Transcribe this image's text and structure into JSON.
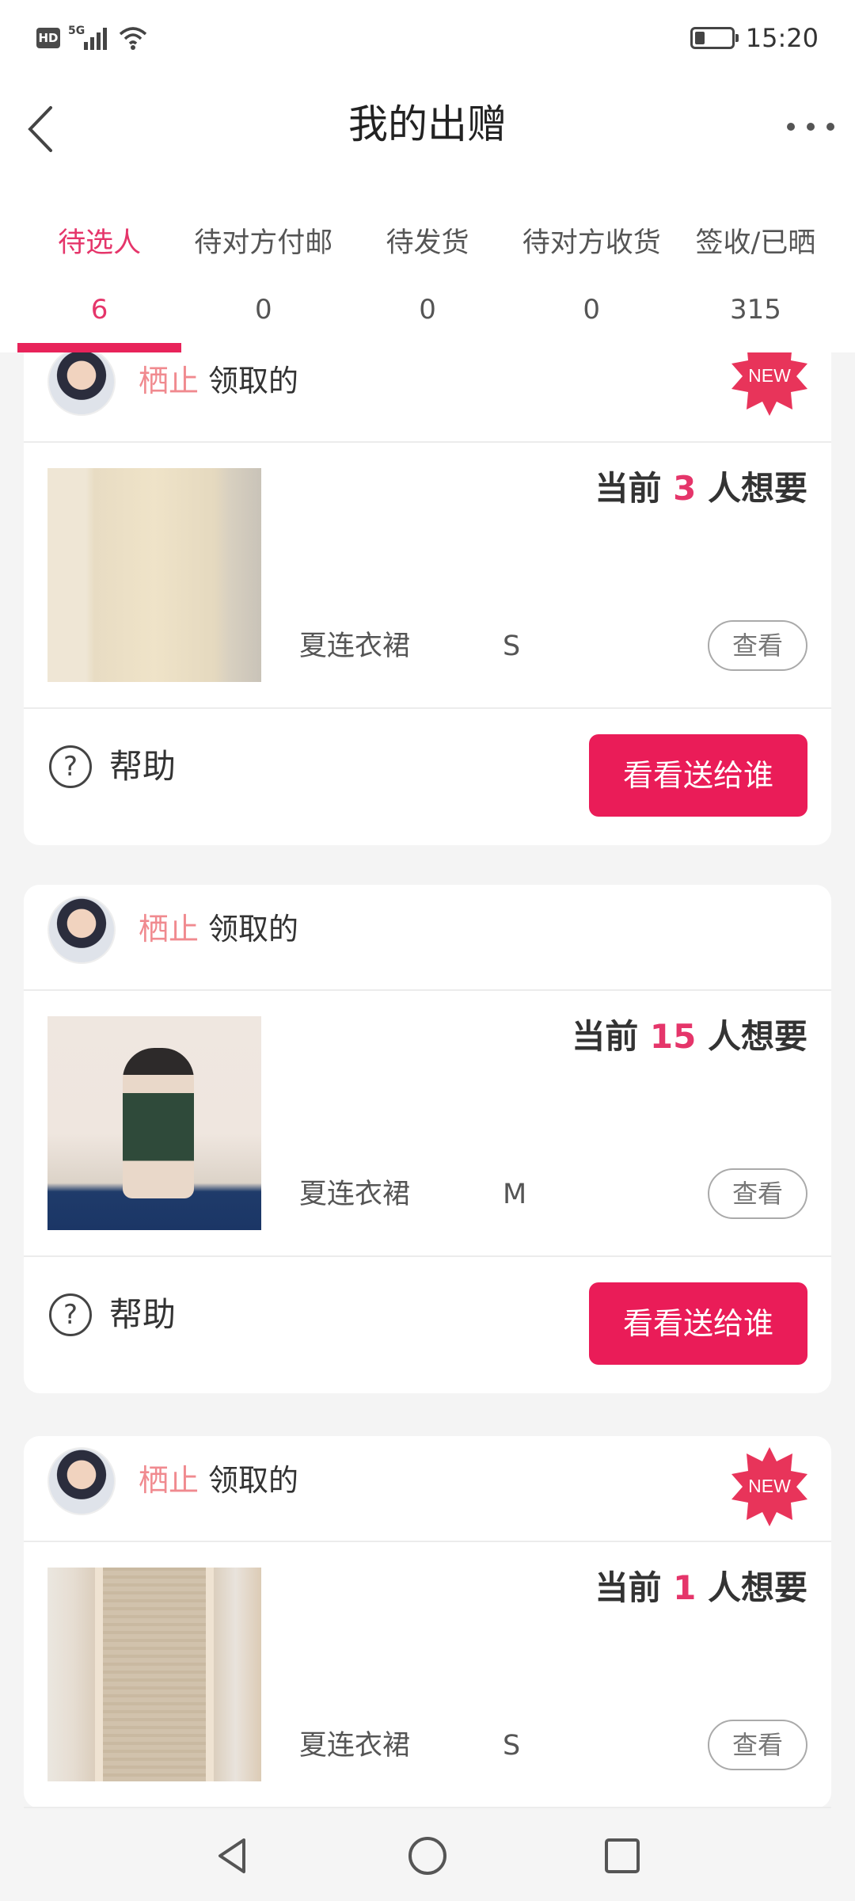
{
  "status_bar": {
    "time": "15:20",
    "hd_label": "HD",
    "network_label": "5G"
  },
  "header": {
    "title": "我的出赠"
  },
  "tabs": [
    {
      "label": "待选人",
      "count": "6",
      "active": true
    },
    {
      "label": "待对方付邮",
      "count": "0"
    },
    {
      "label": "待发货",
      "count": "0"
    },
    {
      "label": "待对方收货",
      "count": "0"
    },
    {
      "label": "签收/已晒",
      "count": "315"
    }
  ],
  "cards": [
    {
      "claimer_name": "栖止",
      "claimer_suffix": "领取的",
      "new_badge": "NEW",
      "want_prefix": "当前",
      "want_count": "3",
      "want_suffix": "人想要",
      "item_name": "夏连衣裙",
      "item_size": "S",
      "view_label": "查看",
      "help_label": "帮助",
      "gift_label": "看看送给谁"
    },
    {
      "claimer_name": "栖止",
      "claimer_suffix": "领取的",
      "want_prefix": "当前",
      "want_count": "15",
      "want_suffix": "人想要",
      "item_name": "夏连衣裙",
      "item_size": "M",
      "view_label": "查看",
      "help_label": "帮助",
      "gift_label": "看看送给谁"
    },
    {
      "claimer_name": "栖止",
      "claimer_suffix": "领取的",
      "new_badge": "NEW",
      "want_prefix": "当前",
      "want_count": "1",
      "want_suffix": "人想要",
      "item_name": "夏连衣裙",
      "item_size": "S",
      "view_label": "查看"
    }
  ],
  "colors": {
    "accent": "#e8235a",
    "claimer_name": "#f08a8f"
  }
}
